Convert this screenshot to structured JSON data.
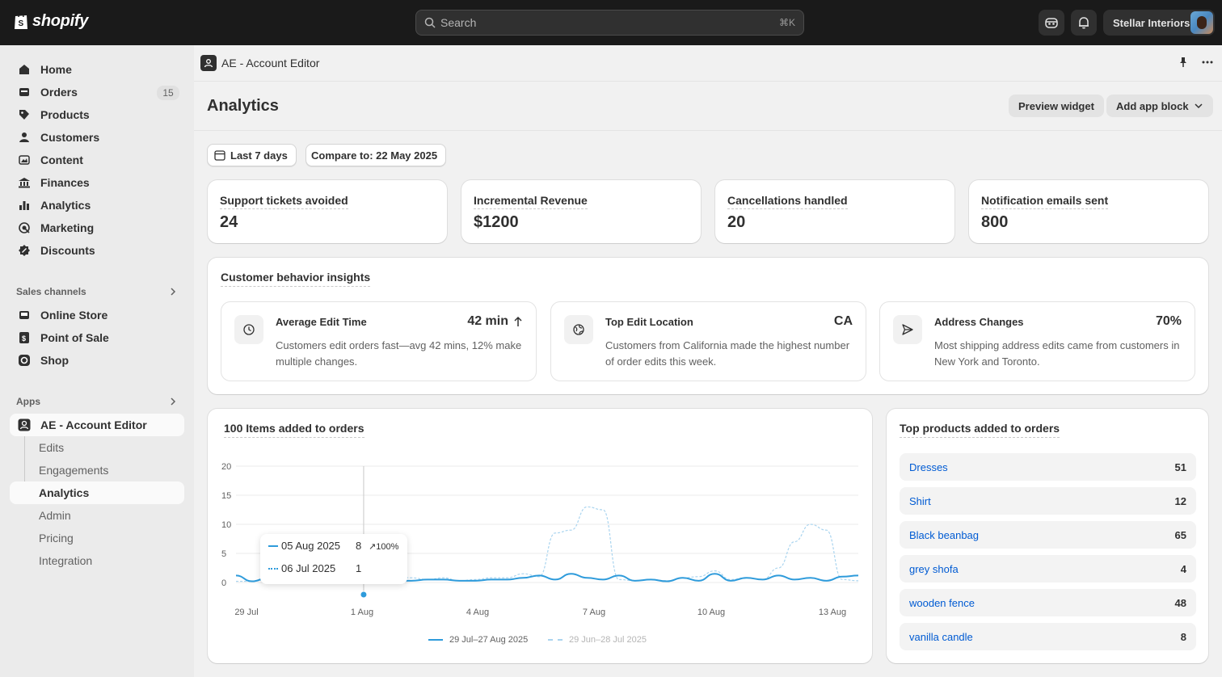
{
  "topbar": {
    "brand": "shopify",
    "search_placeholder": "Search",
    "search_shortcut": "⌘K",
    "store_name": "Stellar Interiors"
  },
  "sidebar": {
    "items": [
      {
        "label": "Home",
        "icon": "home-icon"
      },
      {
        "label": "Orders",
        "icon": "orders-icon",
        "badge": "15"
      },
      {
        "label": "Products",
        "icon": "tag-icon"
      },
      {
        "label": "Customers",
        "icon": "person-icon"
      },
      {
        "label": "Content",
        "icon": "content-icon"
      },
      {
        "label": "Finances",
        "icon": "bank-icon"
      },
      {
        "label": "Analytics",
        "icon": "bar-chart-icon"
      },
      {
        "label": "Marketing",
        "icon": "target-icon"
      },
      {
        "label": "Discounts",
        "icon": "discount-icon"
      }
    ],
    "sales_channels_label": "Sales channels",
    "sales_channels": [
      {
        "label": "Online Store",
        "icon": "storefront-icon"
      },
      {
        "label": "Point of Sale",
        "icon": "pos-icon"
      },
      {
        "label": "Shop",
        "icon": "shop-icon"
      }
    ],
    "apps_label": "Apps",
    "app_name": "AE - Account Editor",
    "app_subitems": [
      "Edits",
      "Engagements",
      "Analytics",
      "Admin",
      "Pricing",
      "Integration"
    ]
  },
  "app_header": {
    "title": "AE - Account Editor"
  },
  "page": {
    "title": "Analytics",
    "preview_widget": "Preview widget",
    "add_app_block": "Add app block",
    "date_filter": "Last 7 days",
    "compare_filter": "Compare to: 22 May 2025"
  },
  "metrics": [
    {
      "label": "Support tickets avoided",
      "value": "24"
    },
    {
      "label": "Incremental Revenue",
      "value": "$1200"
    },
    {
      "label": "Cancellations handled",
      "value": "20"
    },
    {
      "label": "Notification emails sent",
      "value": "800"
    }
  ],
  "insights": {
    "title": "Customer behavior insights",
    "cards": [
      {
        "title": "Average Edit Time",
        "value": "42 min",
        "icon": "clock-icon",
        "trend": "up",
        "desc": "Customers edit orders fast—avg 42 mins, 12% make multiple changes."
      },
      {
        "title": "Top Edit Location",
        "value": "CA",
        "icon": "globe-icon",
        "desc": "Customers from California made the highest number of order edits this week."
      },
      {
        "title": "Address Changes",
        "value": "70%",
        "icon": "send-icon",
        "desc": "Most shipping address edits came from customers in New York and Toronto."
      }
    ]
  },
  "items_chart": {
    "title": "100 Items added to orders",
    "tooltip": {
      "current_date": "05 Aug 2025",
      "current_value": "8",
      "change": "↗100%",
      "previous_date": "06 Jul 2025",
      "previous_value": "1"
    },
    "legend_current": "29 Jul–27 Aug 2025",
    "legend_previous": "29 Jun–28 Jul 2025"
  },
  "chart_data": {
    "type": "line",
    "title": "100 Items added to orders",
    "xlabel": "",
    "ylabel": "",
    "ylim": [
      0,
      20
    ],
    "yticks": [
      "0",
      "5",
      "10",
      "15",
      "20"
    ],
    "xticks": [
      "29 Jul",
      "1 Aug",
      "4 Aug",
      "7 Aug",
      "10 Aug",
      "13 Aug"
    ],
    "grid": true,
    "legend": "bottom",
    "series": [
      {
        "name": "29 Jul–27 Aug 2025",
        "style": "solid",
        "color": "#2e9bdb",
        "values": [
          1.2,
          0.2,
          0.8,
          0.3,
          0.3,
          0.5,
          0.6,
          0.3,
          3.5,
          0.8,
          0.3,
          0.3,
          0.5,
          0.5,
          0.3,
          0.3,
          0.5,
          0.5,
          0.8,
          1.2,
          0.5,
          1.5,
          0.8,
          0.5,
          1.2,
          0.3,
          0.5,
          0.2,
          0.8,
          0.3,
          1.5,
          0.3,
          0.8,
          0.5,
          1.2,
          0.5,
          0.8,
          0.3,
          1.0,
          1.2
        ]
      },
      {
        "name": "29 Jun–28 Jul 2025",
        "style": "dashed",
        "color": "#a9d4ef",
        "values": [
          0.2,
          0.2,
          0.5,
          0.2,
          0.2,
          0.3,
          0.5,
          0.3,
          1.0,
          2.0,
          1.0,
          0.8,
          0.5,
          0.8,
          0.3,
          0.5,
          0.8,
          0.8,
          1.5,
          1.0,
          8.5,
          9.0,
          13.0,
          12.5,
          0.5,
          0.3,
          0.5,
          0.3,
          0.8,
          1.0,
          2.0,
          0.5,
          0.8,
          0.5,
          2.5,
          7.0,
          10.0,
          9.0,
          0.5,
          0.3
        ]
      }
    ],
    "highlight_index": 8
  },
  "top_products": {
    "title": "Top products added to orders",
    "rows": [
      {
        "name": "Dresses",
        "count": "51"
      },
      {
        "name": "Shirt",
        "count": "12"
      },
      {
        "name": "Black beanbag",
        "count": "65"
      },
      {
        "name": "grey shofa",
        "count": "4"
      },
      {
        "name": "wooden fence",
        "count": "48"
      },
      {
        "name": "vanilla candle",
        "count": "8"
      }
    ]
  }
}
